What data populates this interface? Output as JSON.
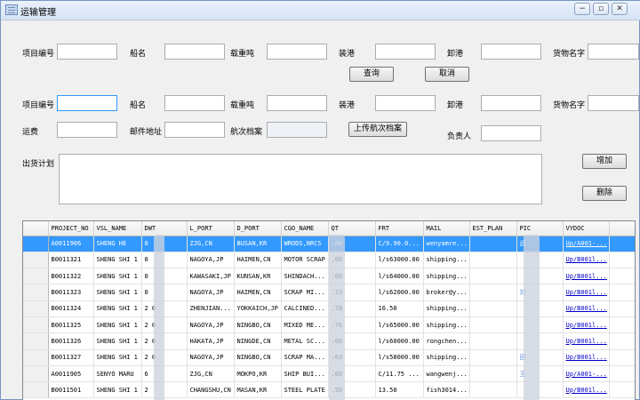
{
  "window": {
    "title": "运输管理",
    "minimize_glyph": "−",
    "restore_glyph": "▫",
    "close_glyph": "✕"
  },
  "search": {
    "project_label": "项目编号",
    "ship_label": "船名",
    "dwt_label": "载重吨",
    "load_port_label": "装港",
    "discharge_port_label": "卸港",
    "cargo_label": "货物名字",
    "query_button": "查询",
    "cancel_button": "取消"
  },
  "form": {
    "project_label": "项目编号",
    "ship_label": "船名",
    "dwt_label": "载重吨",
    "load_port_label": "装港",
    "discharge_port_label": "卸港",
    "cargo_label": "货物名字",
    "freight_label": "运费",
    "mail_label": "邮件地址",
    "voyage_file_label": "航次档案",
    "upload_button": "上传航次档案",
    "owner_label": "负责人",
    "plan_label": "出货计划",
    "add_button": "增加",
    "delete_button": "删除"
  },
  "grid": {
    "columns": [
      "",
      "PROJECT_NO",
      "VSL_NAME",
      "DWT",
      "L_PORT",
      "D_PORT",
      "CGO_NAME",
      "QT",
      "FRT",
      "MAIL",
      "EST_PLAN",
      "PIC",
      "VYDOC"
    ],
    "rows": [
      [
        "",
        "A0011906",
        "SHENG HE",
        "  0",
        "ZJG,CN",
        "BUSAN,KR",
        "WRODS,NRCS",
        ".00",
        "C/9.90.0...",
        "wenyamre...",
        "",
        "远",
        "Up/A001-..."
      ],
      [
        "",
        "B0011321",
        "SHENG SHI 1",
        "  0",
        "NAGOYA,JP",
        "HAIMEN,CN",
        "MOTOR SCRAP",
        ".00",
        "l/s63000.00",
        "shipping...",
        "",
        "",
        "Up/B001l..."
      ],
      [
        "",
        "B0011322",
        "SHENG SHI 1",
        "  0",
        "KAWASAKI,JP",
        "KUNSAN,KR",
        "SHINDACH...",
        ".00",
        "l/s64000.00",
        "shipping...",
        "",
        "",
        "Up/B001l..."
      ],
      [
        "",
        "B0011323",
        "SHENG SHI 1",
        "  0",
        "NAGOYA,JP",
        "HAIMEN,CN",
        "SCRAP MI...",
        ".13",
        "l/s62000.00",
        "broker@y...",
        "",
        "刘",
        "Up/B001l..."
      ],
      [
        "",
        "B0011324",
        "SHENG SHI 1",
        "2  0",
        "ZHENJIAN...",
        "YOKKAICH,JP",
        "CALCINED...",
        ".78",
        "16.50",
        "shipping...",
        "",
        "",
        "Up/B001l..."
      ],
      [
        "",
        "B0011325",
        "SHENG SHI 1",
        "2  0",
        "NAGOYA,JP",
        "NINGBO,CN",
        "MIXED ME...",
        ".76",
        "l/s65000.00",
        "shipping...",
        "",
        "",
        "Up/B001l..."
      ],
      [
        "",
        "B0011326",
        "SHENG SHI 1",
        "2  0",
        "HAKATA,JP",
        "NINGDE,CN",
        "METAL SC...",
        ".00",
        "l/s60000.00",
        "rongchen...",
        "",
        "",
        "Up/B001l..."
      ],
      [
        "",
        "B0011327",
        "SHENG SHI 1",
        "2  0",
        "NAGOYA,JP",
        "NINGBO,CN",
        "SCRAP MA...",
        ".63",
        "l/s58000.00",
        "shipping...",
        "",
        "田",
        "Up/B001l..."
      ],
      [
        "",
        "A0011905",
        "SENYO MARU",
        "6  ",
        "ZJG,CN",
        "MOKPO,KR",
        "SHIP BUI...",
        ".00",
        "C/11.75 ...",
        "wangwenj...",
        "",
        "王",
        "Up/A001-..."
      ],
      [
        "",
        "B0011501",
        "SHENG SHI 1",
        "2  ",
        "CHANGSHU,CN",
        "MASAN,KR",
        "STEEL PLATE",
        ".50",
        "13.50",
        "fish3014...",
        "",
        "",
        "Up/B001l..."
      ]
    ]
  }
}
